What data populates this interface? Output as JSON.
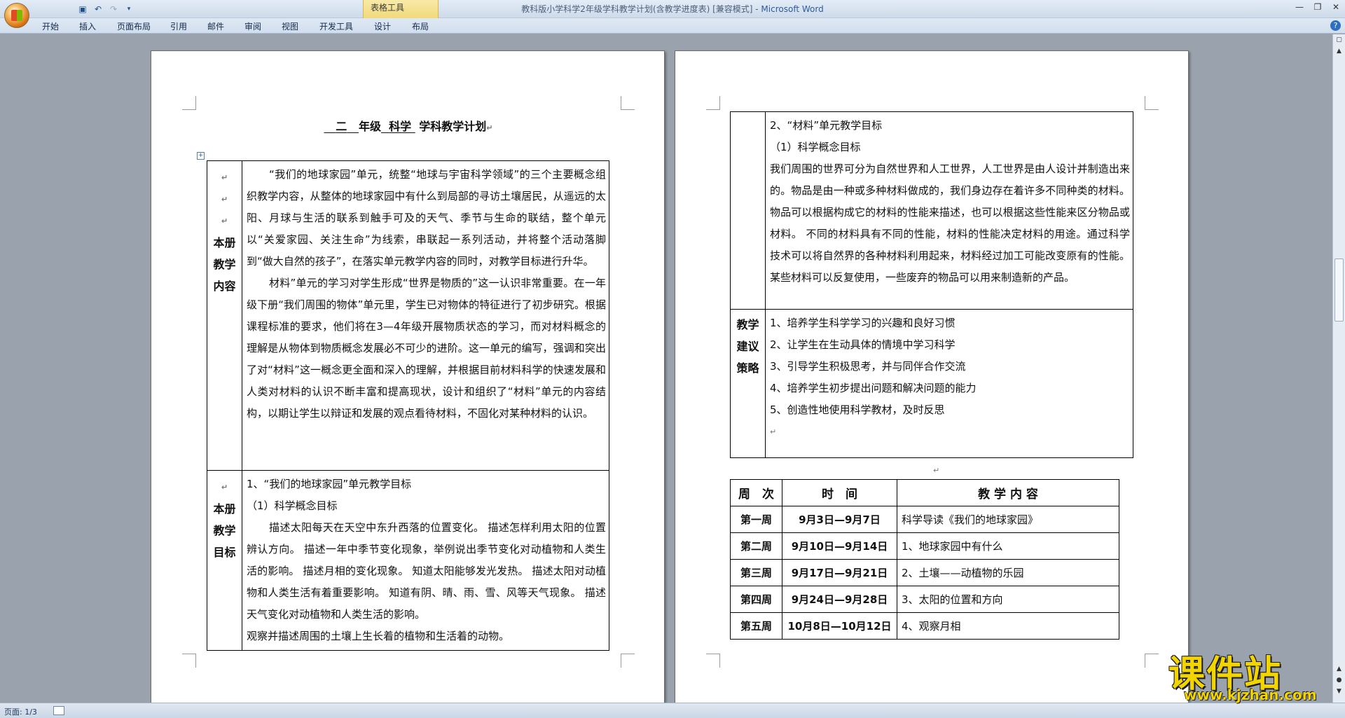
{
  "window": {
    "title_doc": "教科版小学科学2年级学科教学计划(含教学进度表) [兼容模式] - ",
    "title_app": "Microsoft Word",
    "contextual_group": "表格工具"
  },
  "ribbon": {
    "tabs": [
      "开始",
      "插入",
      "页面布局",
      "引用",
      "邮件",
      "审阅",
      "视图",
      "开发工具",
      "设计",
      "布局"
    ]
  },
  "document": {
    "title_grade": "二",
    "title_grade_suffix": "年级",
    "title_subject": "科学",
    "title_tail": "学科教学计划",
    "content_header": "本册教学内容",
    "content_p1": "“我们的地球家园”单元，统整“地球与宇宙科学领域”的三个主要概念组织教学内容，从整体的地球家园中有什么到局部的寻访土壤居民，从遥远的太阳、月球与生活的联系到触手可及的天气、季节与生命的联结，整个单元以“关爱家园、关注生命”为线索，串联起一系列活动，并将整个活动落脚到“做大自然的孩子”，在落实单元教学内容的同时，对教学目标进行升华。",
    "content_p2": "材料”单元的学习对学生形成“世界是物质的”这一认识非常重要。在一年级下册“我们周围的物体”单元里，学生已对物体的特征进行了初步研究。根据课程标准的要求，他们将在3—4年级开展物质状态的学习，而对材料概念的理解是从物体到物质概念发展必不可少的进阶。这一单元的编写，强调和突出了对“材料”这一概念更全面和深入的理解，并根据目前材料科学的快速发展和人类对材料的认识不断丰富和提高现状，设计和组织了“材料”单元的内容结构，以期让学生以辩证和发展的观点看待材料，不固化对某种材料的认识。",
    "goals_header": "本册教学目标",
    "goals_l1": "1、“我们的地球家园”单元教学目标",
    "goals_l2": "（1）科学概念目标",
    "goals_p": "描述太阳每天在天空中东升西落的位置变化。 描述怎样利用太阳的位置辨认方向。 描述一年中季节变化现象，举例说出季节变化对动植物和人类生活的影响。 描述月相的变化现象。 知道太阳能够发光发热。 描述太阳对动植物和人类生活有着重要影响。 知道有阴、晴、雨、雪、风等天气现象。 描述天气变化对动植物和人类生活的影响。",
    "goals_p_end": "观察并描述周围的土壤上生长着的植物和生活着的动物。",
    "material_l1": "2、“材料”单元教学目标",
    "material_l2": "（1）科学概念目标",
    "material_p": "我们周围的世界可分为自然世界和人工世界，人工世界是由人设计并制造出来的。物品是由一种或多种材料做成的，我们身边存在着许多不同种类的材料。 物品可以根据构成它的材料的性能来描述，也可以根据这些性能来区分物品或材料。 不同的材料具有不同的性能，材料的性能决定材料的用途。通过科学技术可以将自然界的各种材料利用起来，材料经过加工可能改变原有的性能。 某些材料可以反复使用，一些废弃的物品可以用来制造新的产品。",
    "strategy_header": "教学建议策略",
    "strategies": [
      "1、培养学生科学学习的兴趣和良好习惯",
      "2、让学生在生动具体的情境中学习科学",
      "3、引导学生积极思考，并与同伴合作交流",
      "4、培养学生初步提出问题和解决问题的能力",
      "5、创造性地使用科学教材，及时反思"
    ],
    "schedule": {
      "headers": [
        "周　次",
        "时　间",
        "教 学 内 容"
      ],
      "rows": [
        {
          "week": "第一周",
          "time": "9月3日—9月7日",
          "content": "科学导读《我们的地球家园》"
        },
        {
          "week": "第二周",
          "time": "9月10日—9月14日",
          "content": "1、地球家园中有什么"
        },
        {
          "week": "第三周",
          "time": "9月17日—9月21日",
          "content": "2、土壤——动植物的乐园"
        },
        {
          "week": "第四周",
          "time": "9月24日—9月28日",
          "content": "3、太阳的位置和方向"
        },
        {
          "week": "第五周",
          "time": "10月8日—10月12日",
          "content": "4、观察月相"
        }
      ]
    }
  },
  "statusbar": {
    "page": "页面: 1/3"
  },
  "watermark": {
    "text": "课件站",
    "url": "www.kjzhan.com"
  }
}
